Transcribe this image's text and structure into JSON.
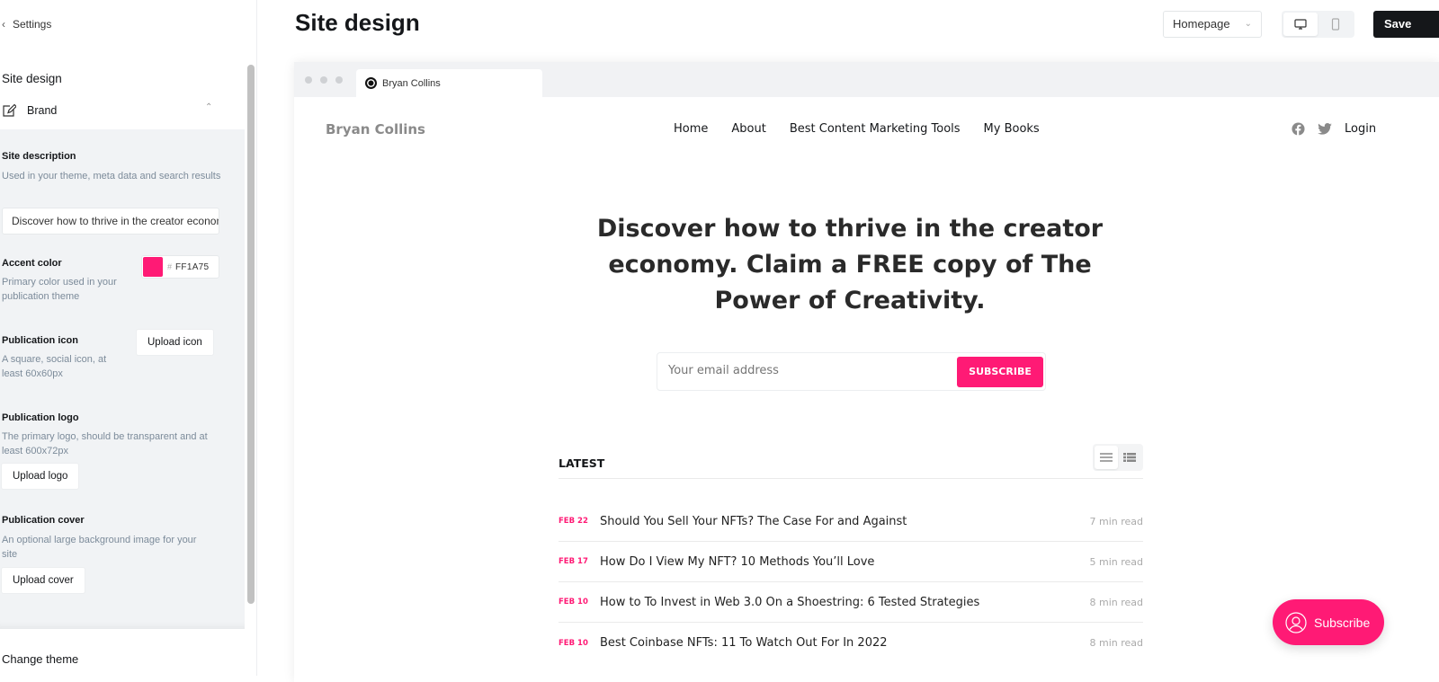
{
  "sidebar": {
    "back_label": "Settings",
    "section_title": "Site design",
    "brand_label": "Brand",
    "site_description": {
      "title": "Site description",
      "desc": "Used in your theme, meta data and search results",
      "value": "Discover how to thrive in the creator economy. Claim a FREE copy of The Power of Creativity."
    },
    "accent_color": {
      "title": "Accent color",
      "desc": "Primary color used in your publication theme",
      "hash": "#",
      "value": "FF1A75",
      "color": "#ff1a75"
    },
    "publication_icon": {
      "title": "Publication icon",
      "desc": "A square, social icon, at least 60x60px",
      "button": "Upload icon"
    },
    "publication_logo": {
      "title": "Publication logo",
      "desc": "The primary logo, should be transparent and at least 600x72px",
      "button": "Upload logo"
    },
    "publication_cover": {
      "title": "Publication cover",
      "desc": "An optional large background image for your site",
      "button": "Upload cover"
    },
    "change_theme": "Change theme"
  },
  "header": {
    "title": "Site design",
    "page_select": "Homepage",
    "save_label": "Save"
  },
  "preview": {
    "tab_title": "Bryan Collins",
    "site": {
      "logo": "Bryan Collins",
      "nav": [
        "Home",
        "About",
        "Best Content Marketing Tools",
        "My Books"
      ],
      "login": "Login",
      "hero": "Discover how to thrive in the creator economy. Claim a FREE copy of The Power of Creativity.",
      "email_placeholder": "Your email address",
      "subscribe_button": "SUBSCRIBE",
      "latest_label": "LATEST",
      "posts": [
        {
          "date": "FEB 22",
          "title": "Should You Sell Your NFTs? The Case For and Against",
          "read_time": "7 min read"
        },
        {
          "date": "FEB 17",
          "title": "How Do I View My NFT? 10 Methods You’ll Love",
          "read_time": "5 min read"
        },
        {
          "date": "FEB 10",
          "title": "How to To Invest in Web 3.0 On a Shoestring: 6 Tested Strategies",
          "read_time": "8 min read"
        },
        {
          "date": "FEB 10",
          "title": "Best Coinbase NFTs: 11 To Watch Out For In 2022",
          "read_time": "8 min read"
        }
      ],
      "floating_subscribe": "Subscribe"
    }
  }
}
